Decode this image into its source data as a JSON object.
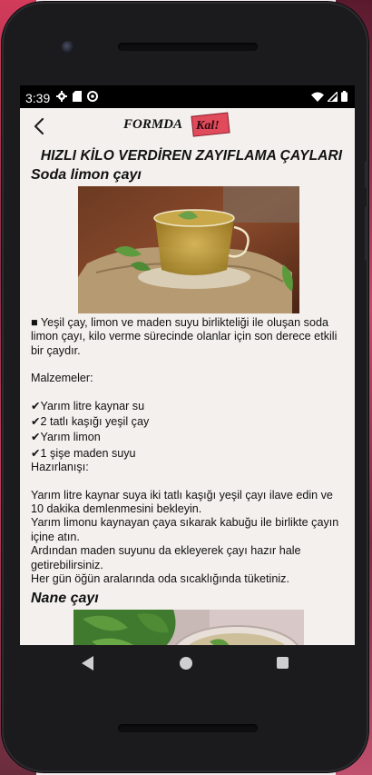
{
  "status_bar": {
    "time": "3:39",
    "left_icons": [
      "gear-icon",
      "sd-card-icon",
      "sync-icon"
    ],
    "right_icons": [
      "wifi-icon",
      "signal-icon",
      "battery-icon"
    ]
  },
  "toolbar": {
    "back_icon": "chevron-left-icon",
    "logo_text_main": "FORMDA",
    "logo_text_accent": "Kal!"
  },
  "article": {
    "title": "HIZLI KİLO VERDİREN ZAYIFLAMA ÇAYLARI",
    "section1": {
      "title": "Soda limon çayı",
      "intro": "■ Yeşil çay, limon ve maden suyu birlikteliği ile oluşan soda limon çayı, kilo verme sürecinde olanlar için son derece etkili bir çaydır.",
      "ingredients_label": "Malzemeler:",
      "ingredients": [
        "✔Yarım litre kaynar su",
        "✔2 tatlı kaşığı yeşil çay",
        "✔Yarım limon",
        "✔1 şişe maden suyu"
      ],
      "preparation_label": "Hazırlanışı:",
      "steps": [
        "Yarım litre kaynar suya iki tatlı kaşığı yeşil çayı ilave edin ve 10 dakika demlenmesini bekleyin.",
        "Yarım limonu kaynayan çaya sıkarak kabuğu ile birlikte çayın içine atın.",
        "Ardından maden suyunu da ekleyerek çayı hazır hale getirebilirsiniz.",
        "Her gün öğün aralarında oda sıcaklığında tüketiniz."
      ]
    },
    "section2": {
      "title": "Nane çayı"
    }
  },
  "colors": {
    "app_background": "#f3f0ed",
    "logo_accent": "#e04a5a"
  }
}
